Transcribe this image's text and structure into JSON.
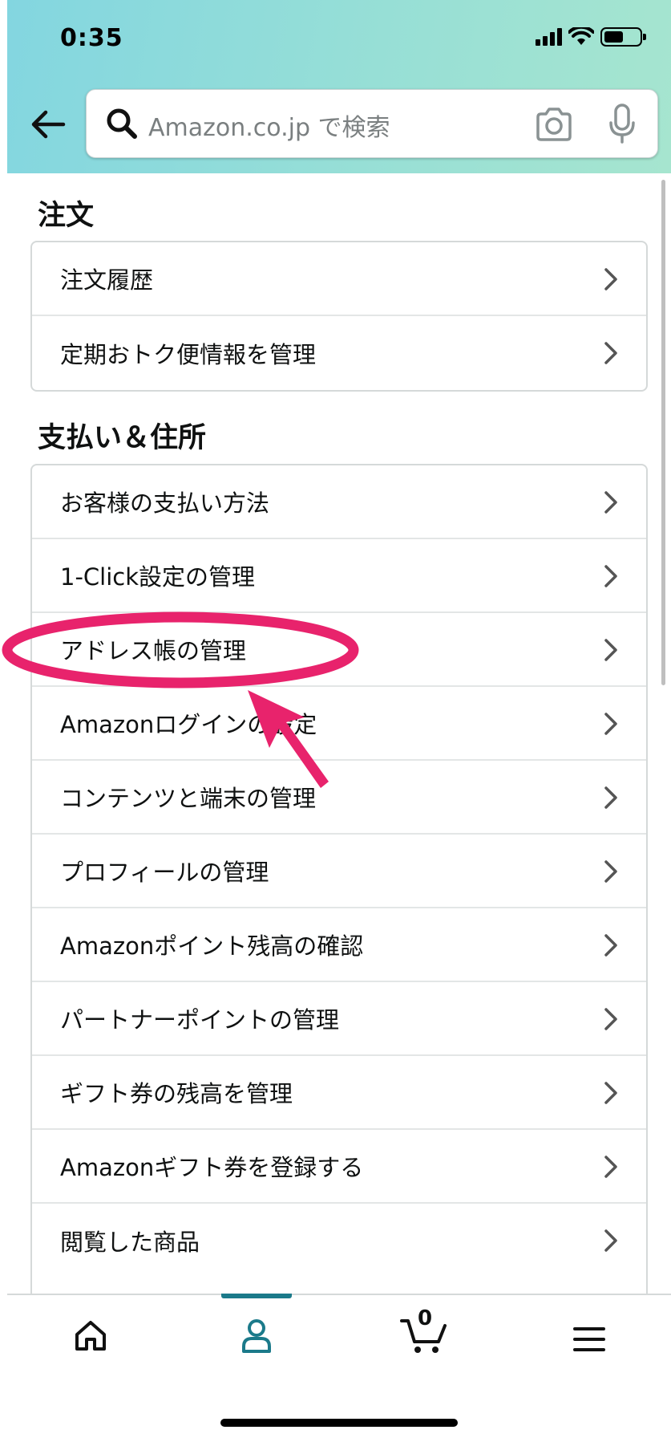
{
  "status_bar": {
    "time": "0:35"
  },
  "search": {
    "placeholder": "Amazon.co.jp で検索"
  },
  "sections": [
    {
      "title": "注文",
      "items": [
        "注文履歴",
        "定期おトク便情報を管理"
      ]
    },
    {
      "title": "支払い＆住所",
      "items": [
        "お客様の支払い方法",
        "1-Click設定の管理",
        "アドレス帳の管理",
        "Amazonログインの設定",
        "コンテンツと端末の管理",
        "プロフィールの管理",
        "Amazonポイント残高の確認",
        "パートナーポイントの管理",
        "ギフト券の残高を管理",
        "Amazonギフト券を登録する",
        "閲覧した商品"
      ]
    }
  ],
  "bottom_nav": {
    "cart_count": "0",
    "active_tab": "account"
  },
  "colors": {
    "annotation": "#e8236c",
    "accent": "#1b7a8a",
    "header_gradient": [
      "#83d6e0",
      "#a6e5cf"
    ]
  },
  "icons": [
    "back-arrow-icon",
    "search-icon",
    "camera-icon",
    "microphone-icon",
    "chevron-right-icon",
    "home-icon",
    "account-icon",
    "cart-icon",
    "menu-icon"
  ]
}
